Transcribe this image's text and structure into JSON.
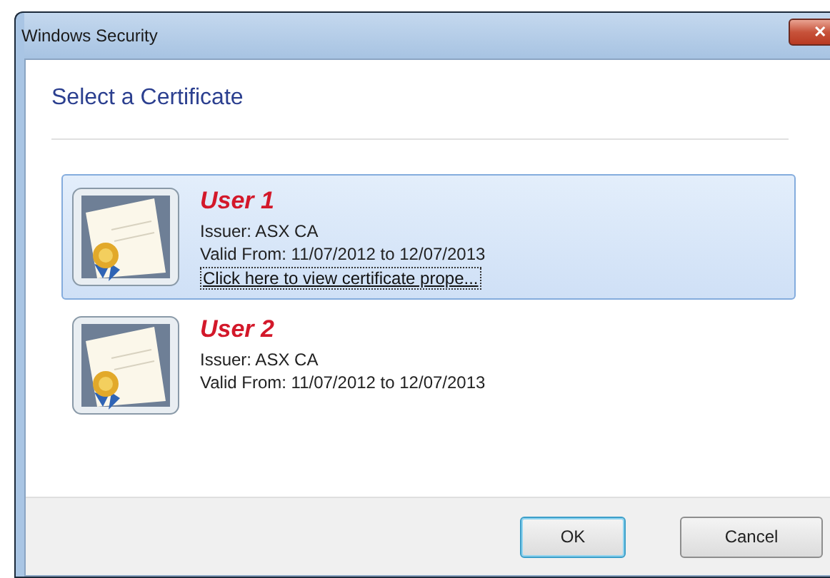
{
  "window": {
    "title": "Windows Security",
    "close": "✕"
  },
  "heading": "Select a Certificate",
  "certificates": [
    {
      "name": "User 1",
      "issuer": "Issuer: ASX CA",
      "valid": "Valid From: 11/07/2012 to 12/07/2013",
      "link": "Click here to view certificate prope...",
      "selected": true
    },
    {
      "name": "User 2",
      "issuer": "Issuer: ASX CA",
      "valid": "Valid From: 11/07/2012 to 12/07/2013",
      "selected": false
    }
  ],
  "buttons": [
    {
      "label": "OK",
      "default": true
    },
    {
      "label": "Cancel",
      "default": false
    }
  ]
}
